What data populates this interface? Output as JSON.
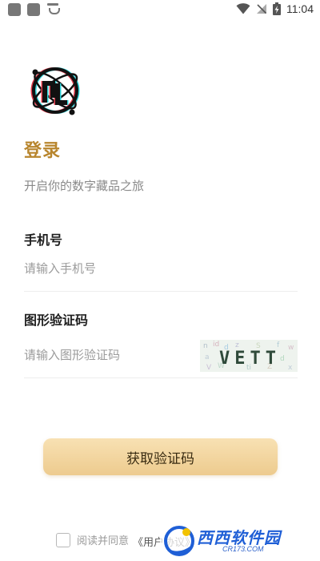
{
  "status_bar": {
    "time": "11:04",
    "icons": [
      "notification-square-icon",
      "notification-square-icon",
      "face-icon",
      "wifi-icon",
      "no-signal-icon",
      "battery-charging-icon"
    ]
  },
  "login": {
    "title": "登录",
    "subtitle": "开启你的数字藏品之旅",
    "phone_label": "手机号",
    "phone_placeholder": "请输入手机号",
    "phone_value": "",
    "captcha_label": "图形验证码",
    "captcha_placeholder": "请输入图形验证码",
    "captcha_value": "",
    "captcha_image_text": "VETT",
    "submit_label": "获取验证码",
    "agree_prefix": "阅读并同意",
    "agree_link": "《用户协议》",
    "agree_checked": false
  },
  "watermark": {
    "text": "西西软件园",
    "sub": "CR173.COM"
  },
  "colors": {
    "accent": "#b8862e",
    "button_top": "#f8e1b3",
    "button_bottom": "#edcb8e"
  }
}
